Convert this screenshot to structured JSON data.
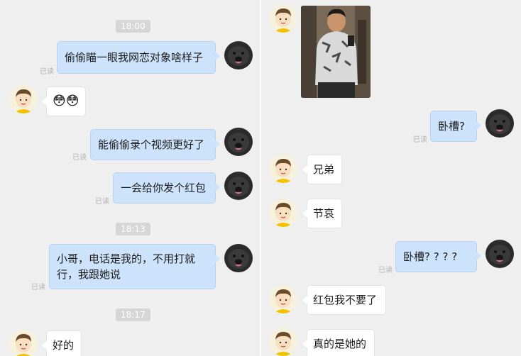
{
  "left": {
    "times": [
      "18:00",
      "18:13",
      "18:17"
    ],
    "read_label": "已读",
    "messages": [
      {
        "text": "偷偷瞄一眼我网恋对象啥样子"
      },
      {
        "text": "能偷偷录个视频更好了"
      },
      {
        "text": "一会给你发个红包"
      },
      {
        "text": "小哥，电话是我的，不用打就"
      },
      {
        "text": "行，我跟她说"
      },
      {
        "text": "好的"
      }
    ],
    "emoji_reply": "😳😳"
  },
  "right": {
    "read_label": "已读",
    "messages": [
      {
        "text": "卧槽?"
      },
      {
        "text": "兄弟"
      },
      {
        "text": "节哀"
      },
      {
        "text": "卧槽? ? ? ?"
      },
      {
        "text": "红包我不要了"
      },
      {
        "text": "真的是她的"
      }
    ]
  },
  "colors": {
    "outgoing_bubble": "#cde3fb",
    "incoming_bubble": "#ffffff",
    "background": "#efefef"
  }
}
